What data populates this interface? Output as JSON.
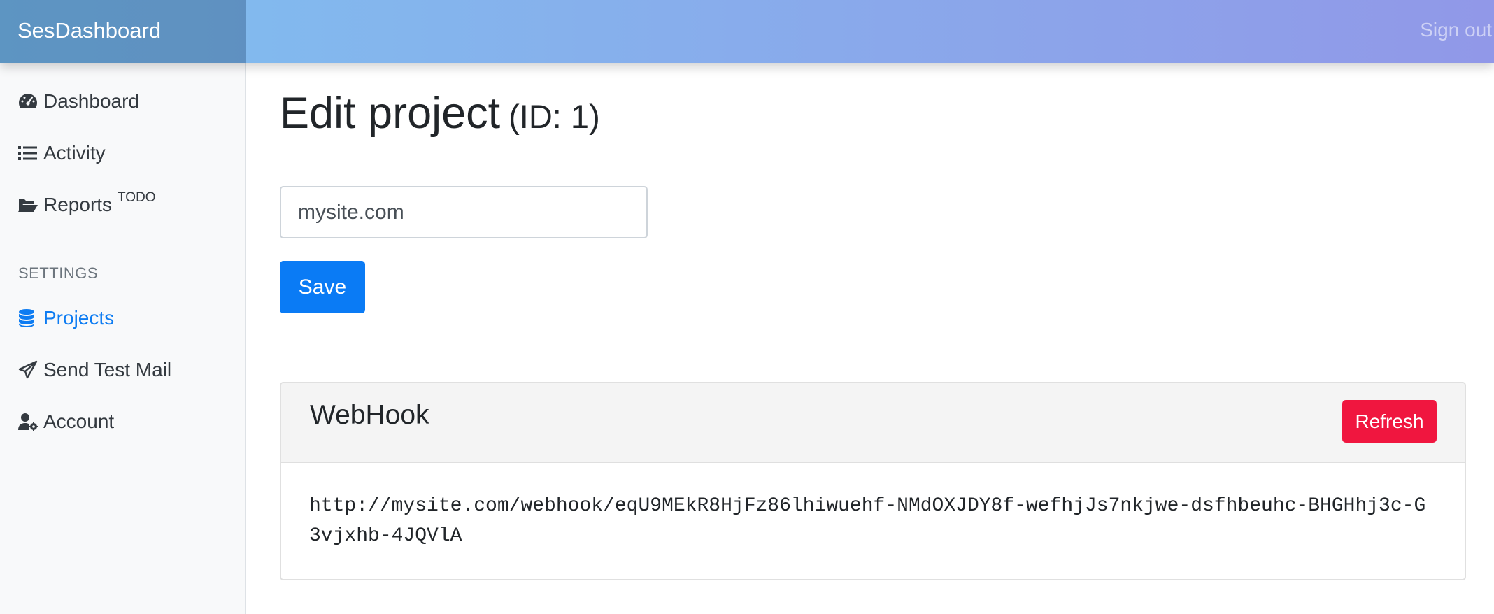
{
  "app": {
    "brand": "SesDashboard",
    "sign_out": "Sign out"
  },
  "sidebar": {
    "items": [
      {
        "label": "Dashboard",
        "icon": "tachometer-icon"
      },
      {
        "label": "Activity",
        "icon": "list-icon"
      },
      {
        "label": "Reports",
        "icon": "folder-open-icon",
        "badge": "TODO"
      }
    ],
    "settings_label": "SETTINGS",
    "settings_items": [
      {
        "label": "Projects",
        "icon": "database-icon",
        "active": true
      },
      {
        "label": "Send Test Mail",
        "icon": "paper-plane-icon"
      },
      {
        "label": "Account",
        "icon": "user-cog-icon"
      }
    ]
  },
  "page": {
    "title": "Edit project",
    "id_label": "(ID: 1)",
    "name_value": "mysite.com",
    "save_label": "Save"
  },
  "webhook": {
    "title": "WebHook",
    "refresh_label": "Refresh",
    "url": "http://mysite.com/webhook/eqU9MEkR8HjFz86lhiwuehf-NMdOXJDY8f-wefhjJs7nkjwe-dsfhbeuhc-BHGHhj3c-G3vjxhb-4JQVlA"
  },
  "colors": {
    "accent": "#0a7bf5",
    "danger": "#f0163f",
    "header_gradient_start": "#7fc0ef",
    "header_gradient_end": "#9198e8"
  }
}
